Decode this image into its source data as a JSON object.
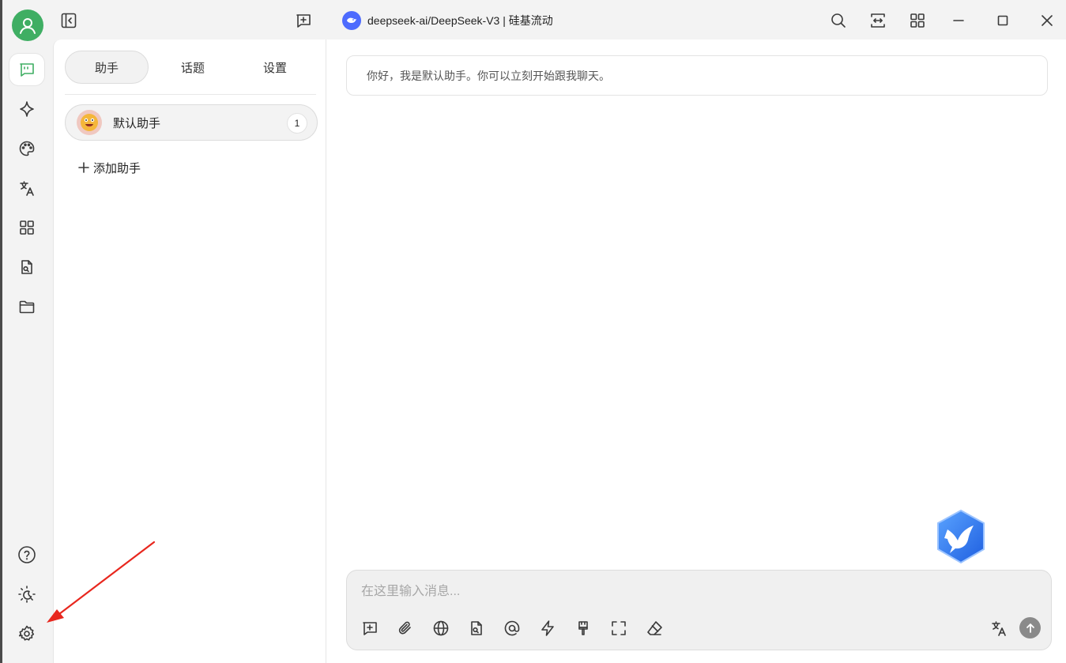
{
  "titlebar": {
    "model_name": "deepseek-ai/DeepSeek-V3 | 硅基流动"
  },
  "panel": {
    "tabs": [
      {
        "label": "助手",
        "active": true
      },
      {
        "label": "话题",
        "active": false
      },
      {
        "label": "设置",
        "active": false
      }
    ],
    "assistant": {
      "name": "默认助手",
      "count": "1"
    },
    "add_label": "添加助手"
  },
  "chat": {
    "greeting": "你好，我是默认助手。你可以立刻开始跟我聊天。",
    "input_placeholder": "在这里输入消息..."
  },
  "rail": {
    "items": [
      "chat-icon",
      "sparkle-icon",
      "palette-icon",
      "translate-icon",
      "apps-icon",
      "file-search-icon",
      "folder-icon"
    ],
    "bottom": [
      "help-icon",
      "theme-icon",
      "gear-icon"
    ]
  },
  "colors": {
    "accent_green": "#3fae63",
    "model_blue": "#4d6bfe",
    "annotation_red": "#e8271e"
  }
}
